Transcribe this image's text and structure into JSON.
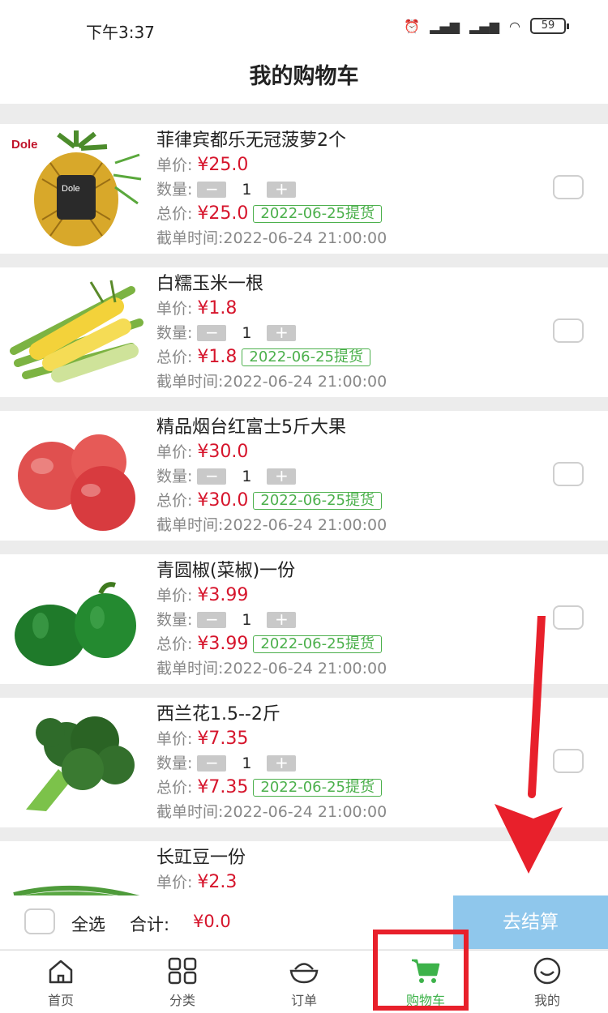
{
  "status_bar": {
    "time": "下午3:37",
    "battery": "59"
  },
  "header": {
    "title": "我的购物车"
  },
  "labels": {
    "unit_price": "单价:",
    "quantity": "数量:",
    "total": "总价:",
    "cutoff": "截单时间:"
  },
  "cart": [
    {
      "name": "菲律宾都乐无冠菠萝2个",
      "unit_price": "¥25.0",
      "quantity": "1",
      "total": "¥25.0",
      "pickup": "2022-06-25提货",
      "cutoff": "2022-06-24 21:00:00",
      "image": "pineapple"
    },
    {
      "name": "白糯玉米一根",
      "unit_price": "¥1.8",
      "quantity": "1",
      "total": "¥1.8",
      "pickup": "2022-06-25提货",
      "cutoff": "2022-06-24 21:00:00",
      "image": "corn"
    },
    {
      "name": "精品烟台红富士5斤大果",
      "unit_price": "¥30.0",
      "quantity": "1",
      "total": "¥30.0",
      "pickup": "2022-06-25提货",
      "cutoff": "2022-06-24 21:00:00",
      "image": "apples"
    },
    {
      "name": "青圆椒(菜椒)一份",
      "unit_price": "¥3.99",
      "quantity": "1",
      "total": "¥3.99",
      "pickup": "2022-06-25提货",
      "cutoff": "2022-06-24 21:00:00",
      "image": "green-peppers"
    },
    {
      "name": "西兰花1.5--2斤",
      "unit_price": "¥7.35",
      "quantity": "1",
      "total": "¥7.35",
      "pickup": "2022-06-25提货",
      "cutoff": "2022-06-24 21:00:00",
      "image": "broccoli"
    },
    {
      "name": "长豇豆一份",
      "unit_price": "¥2.3",
      "image": "long-beans"
    }
  ],
  "qty_minus": "−",
  "qty_plus": "+",
  "checkout": {
    "select_all": "全选",
    "total_label": "合计:",
    "total_value": "¥0.0",
    "button": "去结算"
  },
  "tabs": [
    {
      "label": "首页",
      "icon": "home-icon"
    },
    {
      "label": "分类",
      "icon": "grid-icon"
    },
    {
      "label": "订单",
      "icon": "bowl-icon"
    },
    {
      "label": "购物车",
      "icon": "cart-icon",
      "active": true
    },
    {
      "label": "我的",
      "icon": "smile-icon"
    }
  ],
  "colors": {
    "price": "#d6152c",
    "pickup": "#4cb04c",
    "checkout_button": "#8fc7ec",
    "active_tab": "#3db24a",
    "annotation": "#e8202b"
  }
}
